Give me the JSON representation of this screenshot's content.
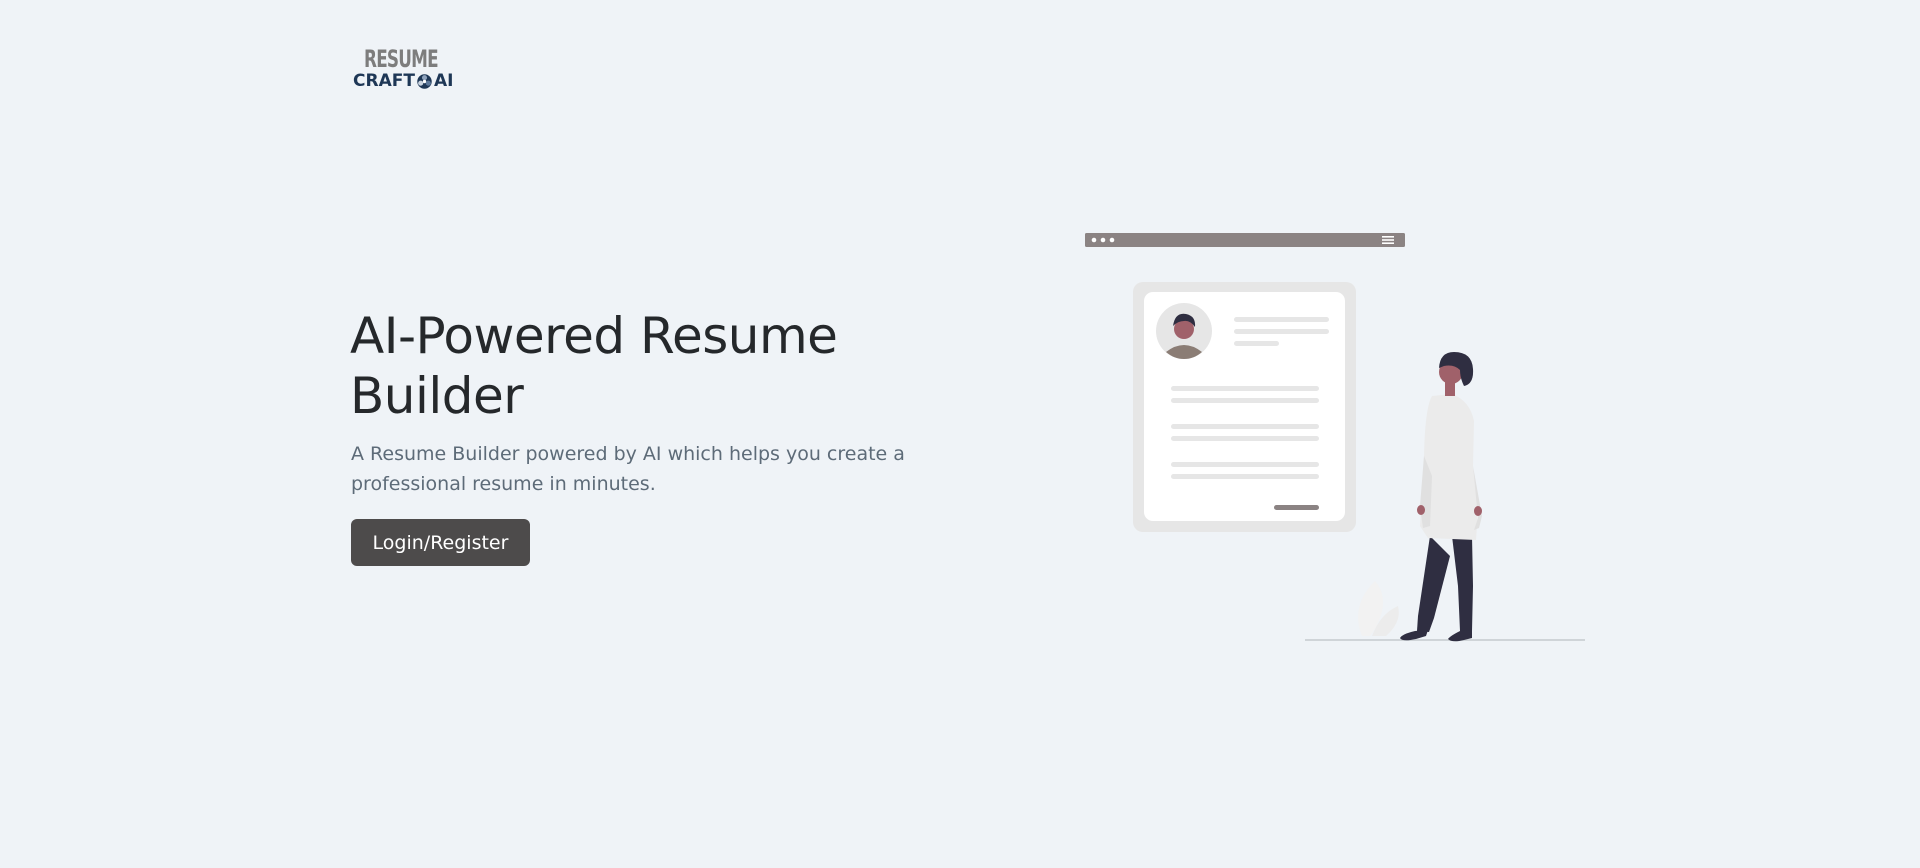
{
  "brand": {
    "logo_top": "RESUME",
    "logo_bottom_left": "CRAFT",
    "logo_bottom_right": "AI",
    "primary_color": "#1e3756",
    "gray_color": "#7d7d7d"
  },
  "hero": {
    "title": "AI-Powered Resume Builder",
    "subtitle": "A Resume Builder powered by AI which helps you create a professional resume in minutes.",
    "cta_label": "Login/Register",
    "cta_color": "#4d4b4b"
  },
  "illustration": {
    "icons": [
      "browser-dots-icon",
      "hamburger-menu-icon",
      "avatar-icon",
      "person-figure",
      "plant-icon"
    ]
  }
}
